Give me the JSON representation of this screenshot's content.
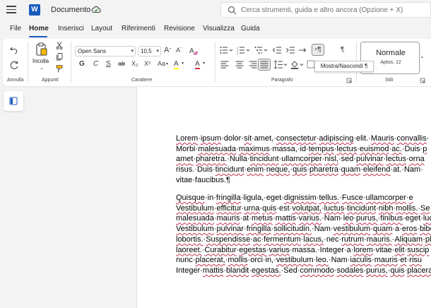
{
  "app": {
    "doc_name": "Documento",
    "search_placeholder": "Cerca strumenti, guida e altro ancora (Opzione + X)"
  },
  "tabs": [
    "File",
    "Home",
    "Inserisci",
    "Layout",
    "Riferimenti",
    "Revisione",
    "Visualizza",
    "Guida"
  ],
  "ribbon": {
    "groups": {
      "annulla": "Annulla",
      "appunti": "Appunti",
      "carattere": "Carattere",
      "paragrafo": "Paragrafo",
      "stili": "Stili"
    },
    "paste_label": "Incolla",
    "font_name": "Open Sans",
    "font_size": "10,5",
    "font_grow": "A",
    "font_shrink": "A",
    "bold": "G",
    "italic": "C",
    "underline": "S",
    "strike": "ab",
    "subscript": "X₂",
    "superscript": "X²",
    "case": "Aa",
    "highlight_glyph": "A",
    "font_color_glyph": "A",
    "pilcrow": "¶",
    "style_name": "Normale",
    "style_font": "Aptos, 12"
  },
  "tooltip": "Mostra/Nascondi ¶",
  "document": {
    "p1": [
      "Lorem·ipsum·dolor·sit·amet,·consectetur·adipiscing·elit.·Mauris·convallis·",
      "Morbi·malesuada·maximus·massa,·id·tempus·lectus·euismod·ac.·Duis·p",
      "amet·pharetra.·Nulla·tincidunt·ullamcorper·nisl,·sed·pulvinar·lectus·orna",
      "risus.·Duis·tincidunt·enim·neque,·quis·pharetra·quam·eleifend·at.·Nam·",
      "vitae·faucibus.¶"
    ],
    "p2": [
      "Quisque·in·fringilla·ligula,·eget·dignissim·tellus.·Fusce·ullamcorper·e",
      "Vestibulum·efficitur·urna·quis·est·volutpat,·luctus·tincidunt·nibh·mollis.·Se",
      "malesuada·mauris·at·metus·mattis·varius.·Nam·leo·purus,·finibus·eget·luc",
      "Vestibulum·pulvinar·fringilla·sollicitudin.·Nam·vestibulum·quam·a·eros·bibe",
      "lobortis.·Suspendisse·ac·fermentum·lacus,·nec·rutrum·mauris.·Aliquam·pl",
      "laoreet.·Curabitur·egestas·varius·massa.·Integer·a·lorem·vitae·elit·suscip",
      "nunc·placerat,·mollis·orci·in,·vestibulum·leo.·Nam·iaculis·mauris·et·risu",
      "Integer·mattis·blandit·egestas.·Sed·commodo·sodales·purus,·quis·placerat·l"
    ]
  }
}
